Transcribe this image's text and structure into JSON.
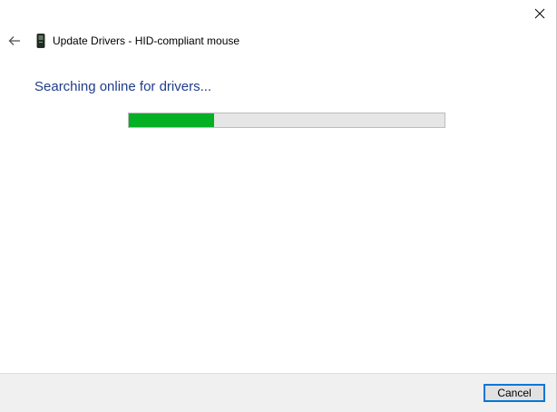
{
  "window": {
    "title": "Update Drivers - HID-compliant mouse"
  },
  "icons": {
    "close": "close-icon",
    "back": "back-arrow-icon",
    "device": "mouse-device-icon"
  },
  "main": {
    "status_text": "Searching online for drivers...",
    "progress_fraction": 0.27
  },
  "footer": {
    "cancel_label": "Cancel"
  },
  "colors": {
    "status_text": "#1f3d8c",
    "progress_fill": "#06b025",
    "progress_track": "#e6e6e6",
    "focus_border": "#0078d7",
    "footer_bg": "#f0f0f0"
  }
}
